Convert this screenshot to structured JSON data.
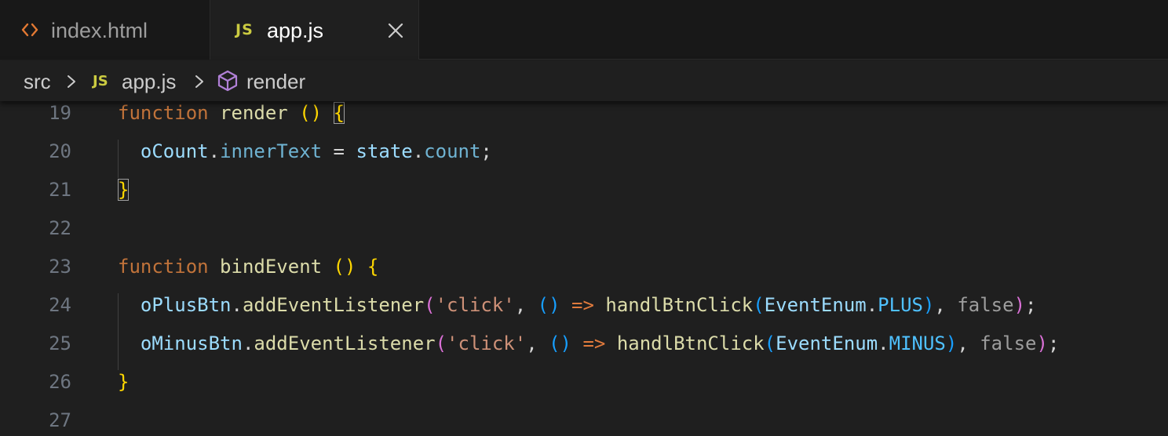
{
  "tabs": [
    {
      "label": "index.html",
      "icon": "html-code-icon",
      "active": false
    },
    {
      "label": "app.js",
      "icon": "js-file-icon",
      "icon_text": "JS",
      "active": true,
      "close_icon": "close-icon"
    }
  ],
  "breadcrumb": {
    "folder": "src",
    "file": "app.js",
    "file_icon_text": "JS",
    "symbol": "render",
    "symbol_icon": "cube-icon"
  },
  "editor": {
    "lines": [
      {
        "number": "19",
        "tokens": [
          {
            "t": "function",
            "c": "kw"
          },
          {
            "t": " ",
            "c": "op"
          },
          {
            "t": "render",
            "c": "fn"
          },
          {
            "t": " ",
            "c": "op"
          },
          {
            "t": "()",
            "c": "br1"
          },
          {
            "t": " ",
            "c": "op"
          },
          {
            "t": "{",
            "c": "br1 matchbox"
          }
        ]
      },
      {
        "number": "20",
        "tokens": [
          {
            "t": "  ",
            "c": "op"
          },
          {
            "t": "oCount",
            "c": "var"
          },
          {
            "t": ".",
            "c": "op"
          },
          {
            "t": "innerText",
            "c": "prop"
          },
          {
            "t": " = ",
            "c": "op"
          },
          {
            "t": "state",
            "c": "var"
          },
          {
            "t": ".",
            "c": "op"
          },
          {
            "t": "count",
            "c": "prop"
          },
          {
            "t": ";",
            "c": "op"
          }
        ]
      },
      {
        "number": "21",
        "tokens": [
          {
            "t": "}",
            "c": "br1 matchbox"
          }
        ]
      },
      {
        "number": "22",
        "tokens": []
      },
      {
        "number": "23",
        "tokens": [
          {
            "t": "function",
            "c": "kw"
          },
          {
            "t": " ",
            "c": "op"
          },
          {
            "t": "bindEvent",
            "c": "fn"
          },
          {
            "t": " ",
            "c": "op"
          },
          {
            "t": "()",
            "c": "br1"
          },
          {
            "t": " ",
            "c": "op"
          },
          {
            "t": "{",
            "c": "br1"
          }
        ]
      },
      {
        "number": "24",
        "tokens": [
          {
            "t": "  ",
            "c": "op"
          },
          {
            "t": "oPlusBtn",
            "c": "var"
          },
          {
            "t": ".",
            "c": "op"
          },
          {
            "t": "addEventListener",
            "c": "fn"
          },
          {
            "t": "(",
            "c": "br2"
          },
          {
            "t": "'click'",
            "c": "str"
          },
          {
            "t": ", ",
            "c": "op"
          },
          {
            "t": "()",
            "c": "br3"
          },
          {
            "t": " ",
            "c": "op"
          },
          {
            "t": "=>",
            "c": "arrow"
          },
          {
            "t": " ",
            "c": "op"
          },
          {
            "t": "handlBtnClick",
            "c": "fn"
          },
          {
            "t": "(",
            "c": "br3"
          },
          {
            "t": "EventEnum",
            "c": "var"
          },
          {
            "t": ".",
            "c": "op"
          },
          {
            "t": "PLUS",
            "c": "const"
          },
          {
            "t": ")",
            "c": "br3"
          },
          {
            "t": ", ",
            "c": "op"
          },
          {
            "t": "false",
            "c": "bool"
          },
          {
            "t": ")",
            "c": "br2"
          },
          {
            "t": ";",
            "c": "op"
          }
        ]
      },
      {
        "number": "25",
        "tokens": [
          {
            "t": "  ",
            "c": "op"
          },
          {
            "t": "oMinusBtn",
            "c": "var"
          },
          {
            "t": ".",
            "c": "op"
          },
          {
            "t": "addEventListener",
            "c": "fn"
          },
          {
            "t": "(",
            "c": "br2"
          },
          {
            "t": "'click'",
            "c": "str"
          },
          {
            "t": ", ",
            "c": "op"
          },
          {
            "t": "()",
            "c": "br3"
          },
          {
            "t": " ",
            "c": "op"
          },
          {
            "t": "=>",
            "c": "arrow"
          },
          {
            "t": " ",
            "c": "op"
          },
          {
            "t": "handlBtnClick",
            "c": "fn"
          },
          {
            "t": "(",
            "c": "br3"
          },
          {
            "t": "EventEnum",
            "c": "var"
          },
          {
            "t": ".",
            "c": "op"
          },
          {
            "t": "MINUS",
            "c": "const"
          },
          {
            "t": ")",
            "c": "br3"
          },
          {
            "t": ", ",
            "c": "op"
          },
          {
            "t": "false",
            "c": "bool"
          },
          {
            "t": ")",
            "c": "br2"
          },
          {
            "t": ";",
            "c": "op"
          }
        ]
      },
      {
        "number": "26",
        "tokens": [
          {
            "t": "}",
            "c": "br1"
          }
        ]
      },
      {
        "number": "27",
        "tokens": []
      }
    ]
  },
  "colors": {
    "background": "#1f1f1f",
    "keyword": "#c1733a",
    "function": "#dcdcaa",
    "variable": "#9cdcfe",
    "string": "#ce9178",
    "bracket_level1": "#ffd700",
    "bracket_level2": "#da70d6",
    "bracket_level3": "#179fff",
    "js_icon": "#cbcb41",
    "html_icon": "#e37933"
  }
}
